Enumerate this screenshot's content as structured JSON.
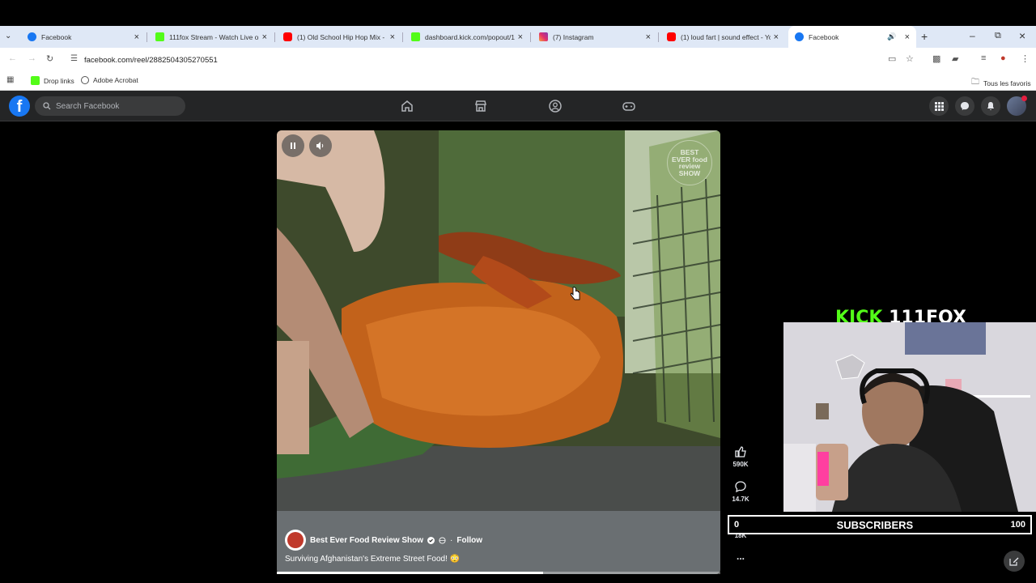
{
  "browser": {
    "tabs": [
      {
        "title": "Facebook",
        "favicon_color": "#1877f2",
        "active": false
      },
      {
        "title": "111fox Stream - Watch Live on",
        "favicon_color": "#53fc18",
        "active": false
      },
      {
        "title": "(1) Old School Hip Hop Mix - S",
        "favicon_color": "#ff0000",
        "active": false
      },
      {
        "title": "dashboard.kick.com/popout/1",
        "favicon_color": "#53fc18",
        "active": false
      },
      {
        "title": "(7) Instagram",
        "favicon_color": "#e1306c",
        "active": false
      },
      {
        "title": "(1) loud fart | sound effect - Yo",
        "favicon_color": "#ff0000",
        "active": false
      },
      {
        "title": "Facebook",
        "favicon_color": "#1877f2",
        "active": true
      }
    ],
    "url": "facebook.com/reel/2882504305270551",
    "bookmarks": [
      {
        "label": "Drop links"
      },
      {
        "label": "Adobe Acrobat"
      }
    ],
    "all_bookmarks_label": "Tous les favoris"
  },
  "facebook": {
    "logo_letter": "f",
    "search_placeholder": "Search Facebook",
    "nav_icons": [
      "home-icon",
      "marketplace-icon",
      "groups-icon",
      "gaming-icon"
    ],
    "right_icons": [
      "menu-grid-icon",
      "messenger-icon",
      "notifications-icon",
      "profile-avatar"
    ]
  },
  "reel": {
    "watermark": "BEST EVER food review SHOW",
    "author": "Best Ever Food Review Show",
    "follow_label": "Follow",
    "separator": "·",
    "caption": "Surviving Afghanistan's Extreme Street Food! 😳",
    "progress": 0.6,
    "likes": "590K",
    "comments": "14.7K",
    "shares": "18K",
    "more": "..."
  },
  "stream_overlay": {
    "title_kick": "KICK",
    "title_channel": "111FOX",
    "subscribers_label": "SUBSCRIBERS",
    "subscribers_current": "0",
    "subscribers_goal": "100",
    "kick_color": "#53fc18"
  }
}
